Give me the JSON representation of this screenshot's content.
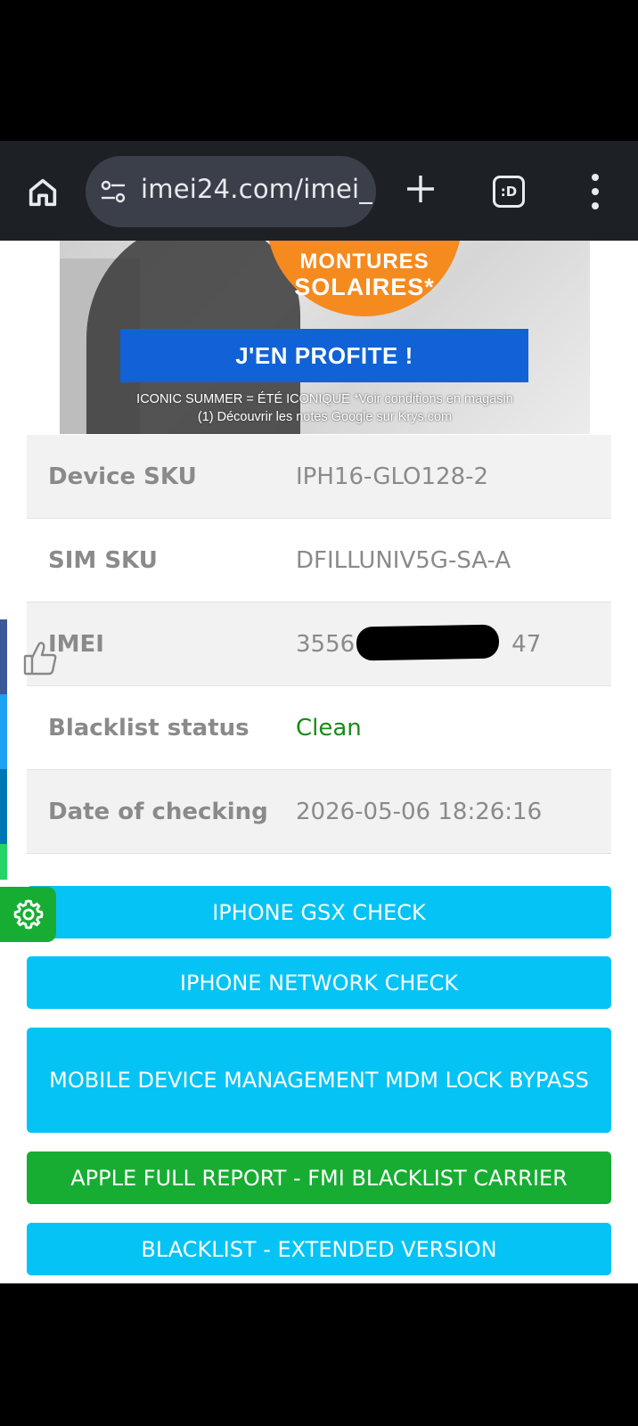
{
  "browser": {
    "url": "imei24.com/imei_",
    "tab_icon_text": ":D"
  },
  "ad": {
    "badge_line1": "MONTURES",
    "badge_line2": "SOLAIRES*",
    "cta": "J'EN PROFITE !",
    "fine_print_1": "ICONIC SUMMER = ÉTÉ ICONIQUE *Voir conditions en magasin",
    "fine_print_2": "(1) Découvrir les notes Google sur Krys.com"
  },
  "info": {
    "rows": [
      {
        "label": "Device SKU",
        "value": "IPH16-GLO128-2"
      },
      {
        "label": "SIM SKU",
        "value": "DFILLUNIV5G-SA-A"
      },
      {
        "label": "IMEI",
        "value": "3556",
        "value_suffix": "47"
      },
      {
        "label": "Blacklist status",
        "value": "Clean"
      },
      {
        "label": "Date of checking",
        "value": "2026-05-06 18:26:16"
      }
    ]
  },
  "actions": [
    {
      "label": "IPHONE GSX CHECK",
      "color": "#05c3f5"
    },
    {
      "label": "IPHONE NETWORK CHECK",
      "color": "#05c3f5"
    },
    {
      "label": "MOBILE DEVICE MANAGEMENT MDM LOCK BYPASS",
      "color": "#05c3f5"
    },
    {
      "label": "APPLE FULL REPORT - FMI BLACKLIST CARRIER",
      "color": "#17ad32"
    },
    {
      "label": "BLACKLIST - EXTENDED VERSION",
      "color": "#05c3f5"
    }
  ],
  "colors": {
    "toolbar_bg": "#1d2025",
    "clean_status": "#1a8a1a",
    "side_tabs": [
      "#3b5998",
      "#1da1f2",
      "#0077b5",
      "#25d366"
    ]
  },
  "icons": [
    "home-icon",
    "site-settings-icon",
    "new-tab-plus-icon",
    "tab-switcher-icon",
    "overflow-menu-icon",
    "thumbs-up-icon",
    "gear-icon"
  ]
}
